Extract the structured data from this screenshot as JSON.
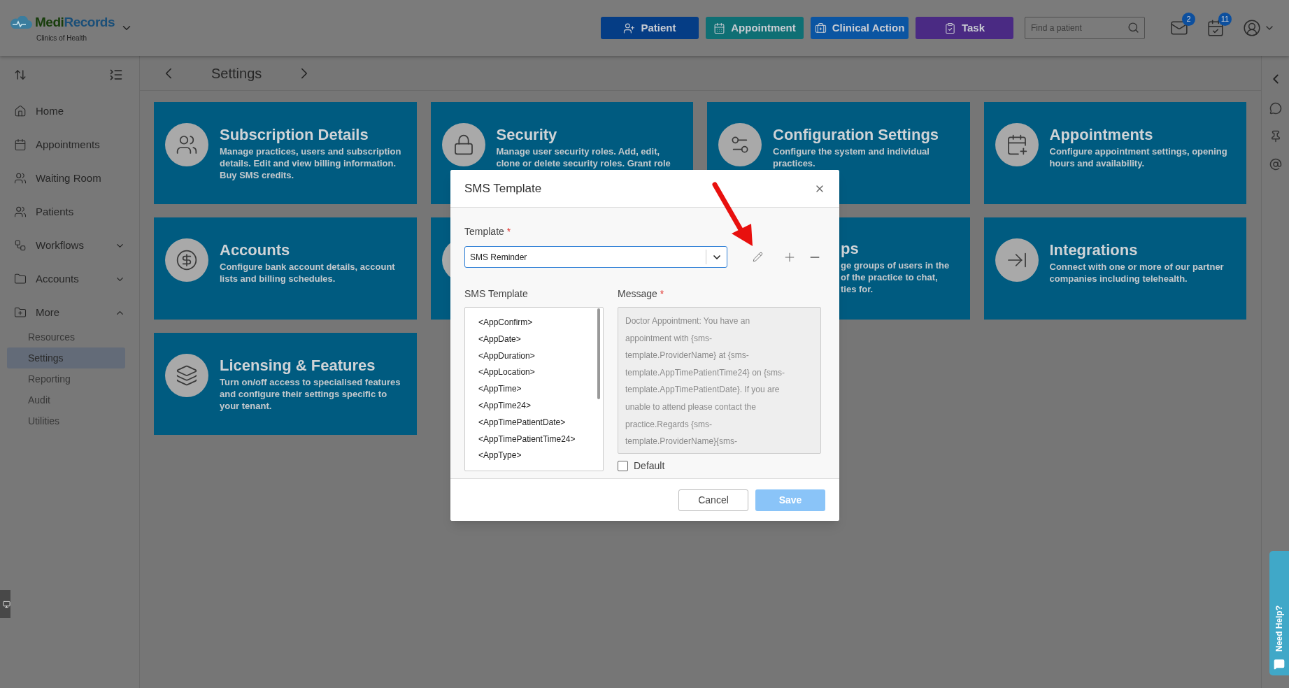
{
  "brand": {
    "name": [
      "Medi",
      "Records"
    ],
    "subtitle": "Clinics of Health"
  },
  "header_buttons": [
    {
      "label": "Patient",
      "color": "#053d85"
    },
    {
      "label": "Appointment",
      "color": "#0f6f74"
    },
    {
      "label": "Clinical Action",
      "color": "#0b55a2"
    },
    {
      "label": "Task",
      "color": "#4a2a83"
    }
  ],
  "search": {
    "placeholder": "Find a patient"
  },
  "notifications": [
    {
      "count": "2"
    },
    {
      "count": "11"
    }
  ],
  "sidebar": {
    "items": [
      {
        "label": "Home"
      },
      {
        "label": "Appointments"
      },
      {
        "label": "Waiting Room"
      },
      {
        "label": "Patients"
      },
      {
        "label": "Workflows",
        "expanded": false
      },
      {
        "label": "Accounts",
        "expanded": false
      },
      {
        "label": "More",
        "expanded": true,
        "children": [
          {
            "label": "Resources",
            "selected": false
          },
          {
            "label": "Settings",
            "selected": true
          },
          {
            "label": "Reporting",
            "selected": false
          },
          {
            "label": "Audit",
            "selected": false
          },
          {
            "label": "Utilities",
            "selected": false
          }
        ]
      }
    ]
  },
  "page": {
    "title": "Settings"
  },
  "cards": [
    {
      "kind": "full",
      "title": "Subscription Details",
      "description": "Manage practices, users and subscription details. Edit and view billing information. Buy SMS credits."
    },
    {
      "kind": "full",
      "title": "Security",
      "description": "Manage user security roles. Add, edit, clone or delete security roles. Grant role"
    },
    {
      "kind": "full",
      "title": "Configuration Settings",
      "description": "Configure the system and individual practices."
    },
    {
      "kind": "full",
      "title": "Appointments",
      "description": "Configure appointment settings, opening hours and availability."
    },
    {
      "kind": "full",
      "title": "Accounts",
      "description": "Configure bank account details, account lists and billing schedules."
    },
    {
      "kind": "hidden"
    },
    {
      "kind": "cut",
      "title": "ps",
      "lines": [
        "ge groups of users in the",
        "of the practice to chat,",
        "ties for."
      ]
    },
    {
      "kind": "full",
      "title": "Integrations",
      "description": "Connect with one or more of our partner companies including telehealth."
    },
    {
      "kind": "full",
      "title": "Licensing & Features",
      "description": "Turn on/off access to specialised features and configure their settings specific to your tenant."
    }
  ],
  "help_tab": {
    "label": "Need Help?"
  },
  "dialog": {
    "title": "SMS Template",
    "template_label": "Template",
    "template_required": "*",
    "template_value": "SMS Reminder",
    "list_label": "SMS Template",
    "list_items": [
      "<AppConfirm>",
      "<AppDate>",
      "<AppDuration>",
      "<AppLocation>",
      "<AppTime>",
      "<AppTime24>",
      "<AppTimePatientDate>",
      "<AppTimePatientTime24>",
      "<AppType>"
    ],
    "message_label": "Message",
    "message_required": "*",
    "message": "Doctor Appointment: You have an appointment with {sms-template.ProviderName} at {sms-template.AppTimePatientTime24} on {sms-template.AppTimePatientDate}. If you are unable to attend please contact the practice.Regards {sms-template.ProviderName}{sms-",
    "default_checkbox": {
      "label": "Default",
      "checked": false
    },
    "buttons": [
      {
        "label": "Cancel",
        "kind": "secondary"
      },
      {
        "label": "Save",
        "kind": "primary",
        "disabled": true
      }
    ]
  }
}
